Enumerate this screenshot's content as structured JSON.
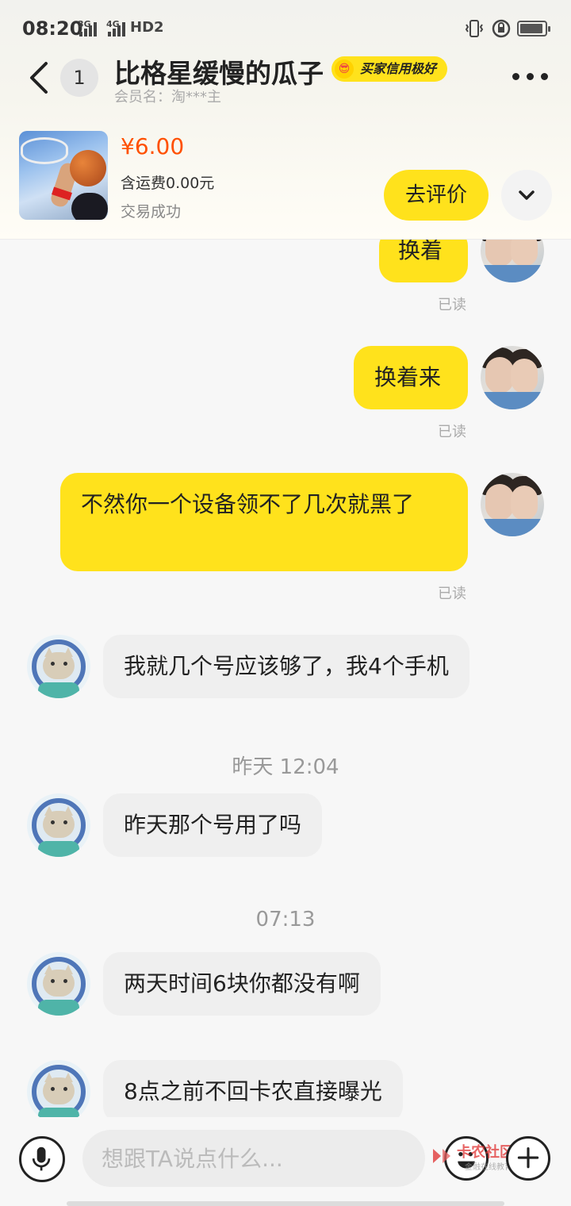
{
  "status_bar": {
    "time": "08:20",
    "net1": "3G",
    "net2": "4G",
    "hd": "HD2"
  },
  "header": {
    "unread_count": "1",
    "title": "比格星缓慢的瓜子",
    "credit_badge": "买家信用极好",
    "member": "会员名：淘***主"
  },
  "product": {
    "price": "¥6.00",
    "shipping": "含运费0.00元",
    "status": "交易成功",
    "review_button": "去评价"
  },
  "messages": [
    {
      "side": "out",
      "text": "换着",
      "read": "已读"
    },
    {
      "side": "out",
      "text": "换着来",
      "read": "已读"
    },
    {
      "side": "out",
      "text": "不然你一个设备领不了几次就黑了",
      "read": "已读"
    },
    {
      "side": "in",
      "text": "我就几个号应该够了，我4个手机"
    },
    {
      "side": "in",
      "text": "昨天那个号用了吗"
    },
    {
      "side": "in",
      "text": "两天时间6块你都没有啊"
    },
    {
      "side": "in",
      "text": "8点之前不回卡农直接曝光"
    }
  ],
  "timestamps": [
    "昨天 12:04",
    "07:13"
  ],
  "input": {
    "placeholder": "想跟TA说点什么..."
  },
  "watermark": {
    "main": "卡农社区",
    "sub": "金融在线教育"
  },
  "colors": {
    "accent_yellow": "#ffe21c",
    "price_orange": "#ff5000",
    "incoming_bubble": "#efefef"
  }
}
